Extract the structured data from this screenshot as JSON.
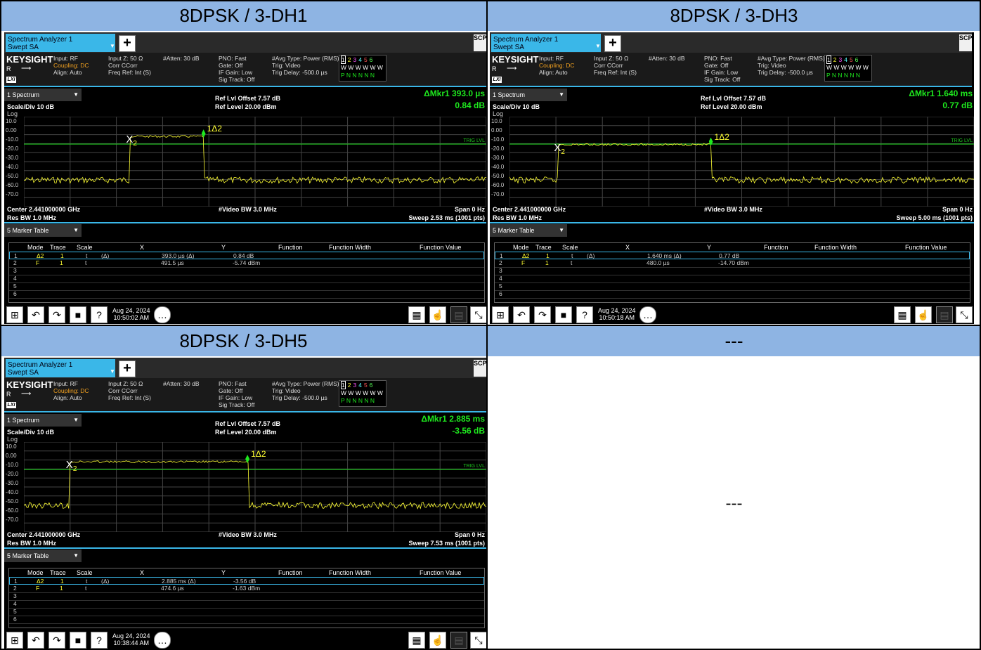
{
  "panels": [
    {
      "title": "8DPSK / 3-DH1",
      "tab_line1": "Spectrum Analyzer 1",
      "tab_line2": "Swept SA",
      "scpi": "SCPI",
      "brand": "KEYSIGHT",
      "input": "Input: RF",
      "coupling": "Coupling: DC",
      "align": "Align: Auto",
      "inputz": "Input Z: 50 Ω",
      "corr": "Corr CCorr",
      "freqref": "Freq Ref: Int (S)",
      "atten": "#Atten: 30 dB",
      "pno": "PNO: Fast",
      "gate": "Gate: Off",
      "ifgain": "IF Gain: Low",
      "sigtrack": "Sig Track: Off",
      "avgtype": "#Avg Type: Power (RMS)",
      "trig": "Trig: Video",
      "trigdelay": "Trig Delay: -500.0 µs",
      "spectrum_sel": "1 Spectrum",
      "scale": "Scale/Div 10 dB",
      "log": "Log",
      "reflvl_offset": "Ref Lvl Offset 7.57 dB",
      "reflevel": "Ref Level 20.00 dBm",
      "mkr_label": "ΔMkr1  393.0 µs",
      "mkr_val": "0.84 dB",
      "center": "Center 2.441000000 GHz",
      "resbw": "Res BW 1.0 MHz",
      "vbw": "#Video BW 3.0 MHz",
      "span": "Span 0 Hz",
      "sweep": "Sweep 2.53 ms (1001 pts)",
      "marker_sel": "5 Marker Table",
      "date": "Aug 24, 2024",
      "time": "10:50:02 AM",
      "rows": [
        {
          "n": "1",
          "mode": "Δ2",
          "trace": "1",
          "scale": "t",
          "d": "(Δ)",
          "x": "393.0 µs (Δ)",
          "y": "0.84 dB"
        },
        {
          "n": "2",
          "mode": "F",
          "trace": "1",
          "scale": "t",
          "d": "",
          "x": "491.5 µs",
          "y": "-5.74 dBm"
        },
        {
          "n": "3"
        },
        {
          "n": "4"
        },
        {
          "n": "5"
        },
        {
          "n": "6"
        }
      ],
      "burst": {
        "start": 0.23,
        "end": 0.39,
        "high": 0.22
      }
    },
    {
      "title": "8DPSK / 3-DH3",
      "tab_line1": "Spectrum Analyzer 1",
      "tab_line2": "Swept SA",
      "scpi": "SCPI",
      "brand": "KEYSIGHT",
      "input": "Input: RF",
      "coupling": "Coupling: DC",
      "align": "Align: Auto",
      "inputz": "Input Z: 50 Ω",
      "corr": "Corr CCorr",
      "freqref": "Freq Ref: Int (S)",
      "atten": "#Atten: 30 dB",
      "pno": "PNO: Fast",
      "gate": "Gate: Off",
      "ifgain": "IF Gain: Low",
      "sigtrack": "Sig Track: Off",
      "avgtype": "#Avg Type: Power (RMS)",
      "trig": "Trig: Video",
      "trigdelay": "Trig Delay: -500.0 µs",
      "spectrum_sel": "1 Spectrum",
      "scale": "Scale/Div 10 dB",
      "log": "Log",
      "reflvl_offset": "Ref Lvl Offset 7.57 dB",
      "reflevel": "Ref Level 20.00 dBm",
      "mkr_label": "ΔMkr1  1.640 ms",
      "mkr_val": "0.77 dB",
      "center": "Center 2.441000000 GHz",
      "resbw": "Res BW 1.0 MHz",
      "vbw": "#Video BW 3.0 MHz",
      "span": "Span 0 Hz",
      "sweep": "Sweep 5.00 ms (1001 pts)",
      "marker_sel": "5 Marker Table",
      "date": "Aug 24, 2024",
      "time": "10:50:18 AM",
      "rows": [
        {
          "n": "1",
          "mode": "Δ2",
          "trace": "1",
          "scale": "t",
          "d": "(Δ)",
          "x": "1.640 ms (Δ)",
          "y": "0.77 dB"
        },
        {
          "n": "2",
          "mode": "F",
          "trace": "1",
          "scale": "t",
          "d": "",
          "x": "480.0 µs",
          "y": "-14.70 dBm"
        },
        {
          "n": "3"
        },
        {
          "n": "4"
        },
        {
          "n": "5"
        },
        {
          "n": "6"
        }
      ],
      "burst": {
        "start": 0.105,
        "end": 0.435,
        "high": 0.31
      }
    },
    {
      "title": "8DPSK / 3-DH5",
      "tab_line1": "Spectrum Analyzer 1",
      "tab_line2": "Swept SA",
      "scpi": "SCPI",
      "brand": "KEYSIGHT",
      "input": "Input: RF",
      "coupling": "Coupling: DC",
      "align": "Align: Auto",
      "inputz": "Input Z: 50 Ω",
      "corr": "Corr CCorr",
      "freqref": "Freq Ref: Int (S)",
      "atten": "#Atten: 30 dB",
      "pno": "PNO: Fast",
      "gate": "Gate: Off",
      "ifgain": "IF Gain: Low",
      "sigtrack": "Sig Track: Off",
      "avgtype": "#Avg Type: Power (RMS)",
      "trig": "Trig: Video",
      "trigdelay": "Trig Delay: -500.0 µs",
      "spectrum_sel": "1 Spectrum",
      "scale": "Scale/Div 10 dB",
      "log": "Log",
      "reflvl_offset": "Ref Lvl Offset 7.57 dB",
      "reflevel": "Ref Level 20.00 dBm",
      "mkr_label": "ΔMkr1  2.885 ms",
      "mkr_val": "-3.56 dB",
      "center": "Center 2.441000000 GHz",
      "resbw": "Res BW 1.0 MHz",
      "vbw": "#Video BW 3.0 MHz",
      "span": "Span 0 Hz",
      "sweep": "Sweep 7.53 ms (1001 pts)",
      "marker_sel": "5 Marker Table",
      "date": "Aug 24, 2024",
      "time": "10:38:44 AM",
      "rows": [
        {
          "n": "1",
          "mode": "Δ2",
          "trace": "1",
          "scale": "t",
          "d": "(Δ)",
          "x": "2.885 ms (Δ)",
          "y": "-3.56 dB"
        },
        {
          "n": "2",
          "mode": "F",
          "trace": "1",
          "scale": "t",
          "d": "",
          "x": "474.6 µs",
          "y": "-1.63 dBm"
        },
        {
          "n": "3"
        },
        {
          "n": "4"
        },
        {
          "n": "5"
        },
        {
          "n": "6"
        }
      ],
      "burst": {
        "start": 0.1,
        "end": 0.485,
        "high": 0.22
      }
    }
  ],
  "empty_panel": {
    "title": "---",
    "body": "---"
  },
  "common": {
    "yticks": [
      "10.0",
      "0.00",
      "-10.0",
      "-20.0",
      "-30.0",
      "-40.0",
      "-50.0",
      "-60.0",
      "-70.0"
    ],
    "headers": {
      "mode": "Mode",
      "trace": "Trace",
      "scale": "Scale",
      "x": "X",
      "y": "Y",
      "func": "Function",
      "fw": "Function Width",
      "fv": "Function Value"
    },
    "trig_lvl": "TRIG LVL",
    "marker_x": "X",
    "marker_x_sub": "2",
    "marker_delta": "1Δ2",
    "trace_nums": [
      "1",
      "2",
      "3",
      "4",
      "5",
      "6"
    ],
    "trace_types": "W W W W W W",
    "trace_dets": "P N N N N N",
    "colors": {
      "trace": "#ffff33",
      "trig": "#1ec81e",
      "accent": "#3ab7e8",
      "header": "#8eb4e3",
      "marker": "#1ee81e"
    }
  }
}
